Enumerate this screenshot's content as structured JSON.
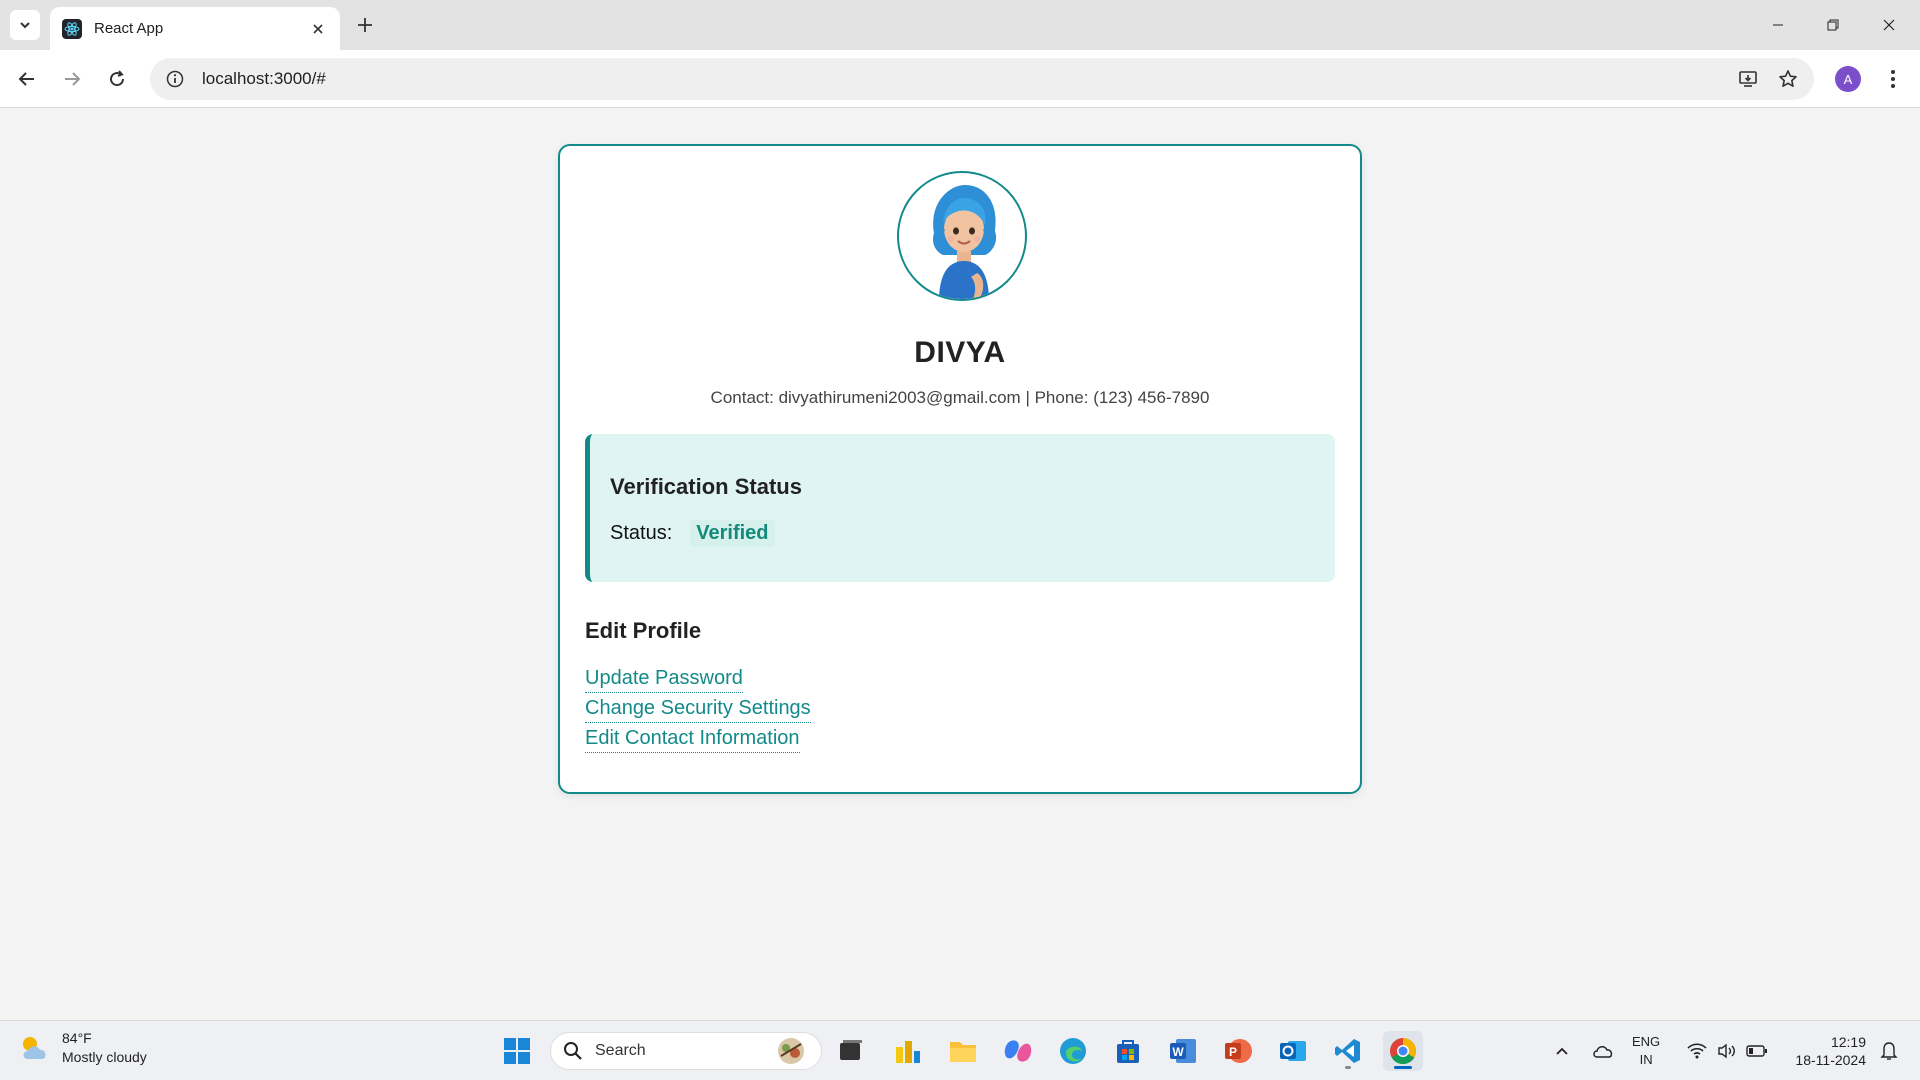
{
  "browser": {
    "tab_title": "React App",
    "url": "localhost:3000/#",
    "profile_initial": "A"
  },
  "profile": {
    "name": "DIVYA",
    "contact_line": "Contact: divyathirumeni2003@gmail.com | Phone: (123) 456-7890",
    "avatar_icon": "woman-blue-hair-avatar"
  },
  "verification": {
    "title": "Verification Status",
    "status_label": "Status:",
    "status_value": "Verified"
  },
  "edit_profile": {
    "title": "Edit Profile",
    "links": [
      "Update Password",
      "Change Security Settings",
      "Edit Contact Information"
    ]
  },
  "taskbar": {
    "weather_temp": "84°F",
    "weather_desc": "Mostly cloudy",
    "search_placeholder": "Search",
    "lang_line1": "ENG",
    "lang_line2": "IN",
    "time": "12:19",
    "date": "18-11-2024"
  },
  "colors": {
    "accent": "#138a8a",
    "verify_bg": "#e0f5f3",
    "status_green": "#138a7a"
  }
}
